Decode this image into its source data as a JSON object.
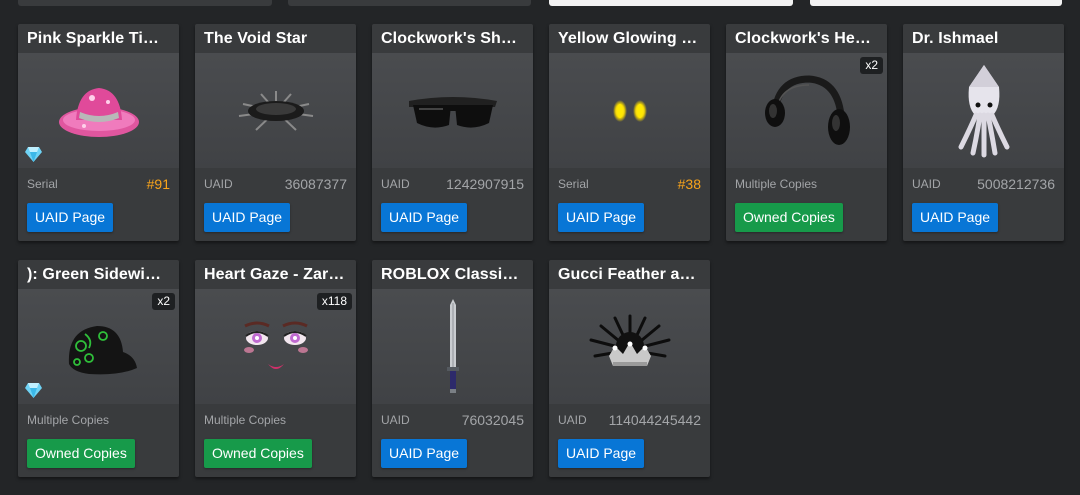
{
  "colors": {
    "background": "#232527",
    "card": "#393b3d",
    "serial_orange": "#f7a31b",
    "uaid_button_blue": "#0876d6",
    "owned_button_green": "#179a4a"
  },
  "items": [
    {
      "title": "Pink Sparkle Tim...",
      "meta_label": "Serial",
      "meta_value": "#91",
      "button": "UAID Page",
      "icon": "pink-sparkle-hat-icon"
    },
    {
      "title": "The Void Star",
      "meta_label": "UAID",
      "meta_value": "36087377",
      "button": "UAID Page",
      "icon": "void-star-icon"
    },
    {
      "title": "Clockwork's Shad...",
      "meta_label": "UAID",
      "meta_value": "1242907915",
      "button": "UAID Page",
      "icon": "shades-icon"
    },
    {
      "title": "Yellow Glowing E...",
      "meta_label": "Serial",
      "meta_value": "#38",
      "button": "UAID Page",
      "icon": "glowing-eyes-icon"
    },
    {
      "title": "Clockwork's Head...",
      "meta_label": "Multiple Copies",
      "meta_value": "",
      "button": "Owned Copies",
      "badge": "x2",
      "icon": "headphones-icon"
    },
    {
      "title": "Dr. Ishmael",
      "meta_label": "UAID",
      "meta_value": "5008212736",
      "button": "UAID Page",
      "icon": "squid-icon"
    },
    {
      "title": "): Green Sidewind...",
      "meta_label": "Multiple Copies",
      "meta_value": "",
      "button": "Owned Copies",
      "badge": "x2",
      "icon": "green-sidewinder-hat-icon"
    },
    {
      "title": "Heart Gaze - Zara...",
      "meta_label": "Multiple Copies",
      "meta_value": "",
      "button": "Owned Copies",
      "badge": "x118",
      "icon": "heart-gaze-face-icon"
    },
    {
      "title": "ROBLOX Classic ...",
      "meta_label": "UAID",
      "meta_value": "76032045",
      "button": "UAID Page",
      "icon": "sword-icon"
    },
    {
      "title": "Gucci Feather an...",
      "meta_label": "UAID",
      "meta_value": "114044245442",
      "button": "UAID Page",
      "icon": "feather-crown-icon"
    }
  ]
}
